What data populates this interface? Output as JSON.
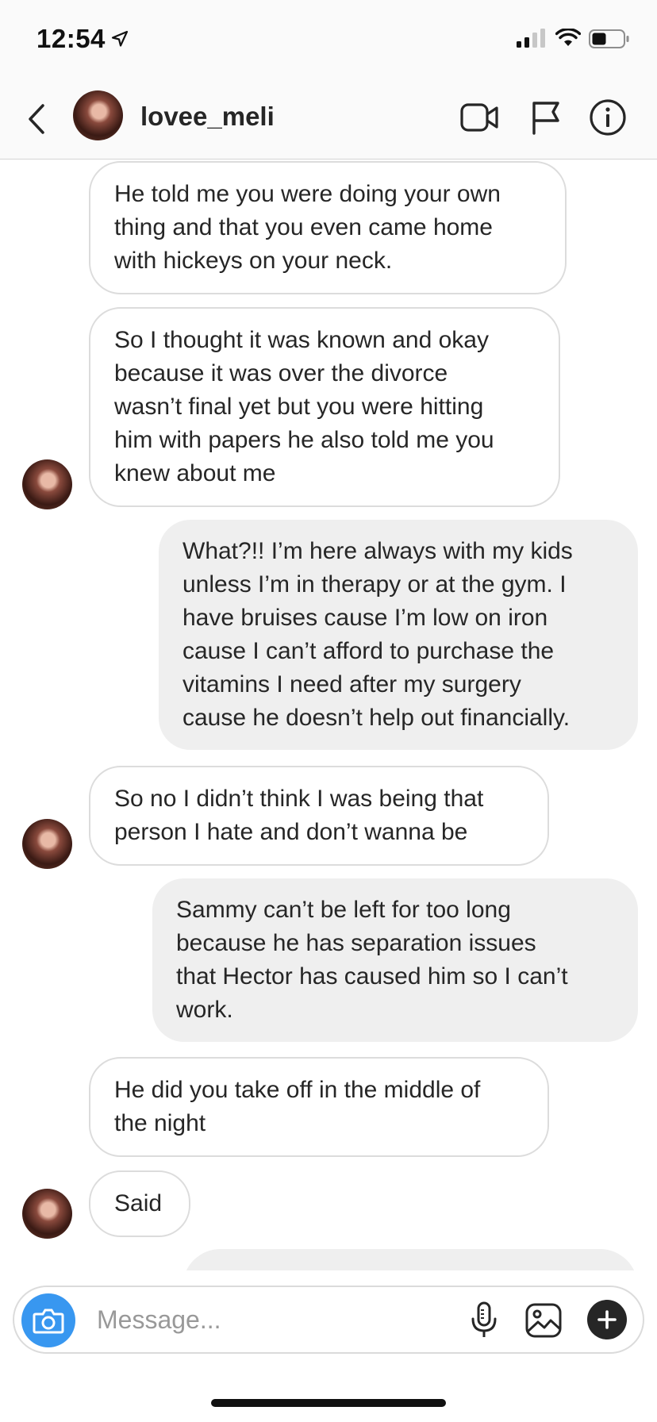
{
  "status_bar": {
    "time": "12:54"
  },
  "header": {
    "username": "lovee_meli"
  },
  "messages": [
    {
      "direction": "incoming",
      "text": "He told me you were doing your own\nthing and that you even came home\nwith hickeys on your neck."
    },
    {
      "direction": "incoming",
      "text": "So I thought it was known and okay\nbecause it was over the divorce\nwasn’t final yet but you were hitting\nhim with papers he also told me you\nknew about me"
    },
    {
      "direction": "outgoing",
      "text": "What?!! I’m here always with my kids\nunless I’m in therapy or at the gym. I\nhave bruises cause I’m low on iron\ncause I can’t afford to purchase the\nvitamins I need after my surgery\ncause he doesn’t help out financially."
    },
    {
      "direction": "incoming",
      "text": "So no I didn’t think I was being that\nperson I hate and don’t wanna be"
    },
    {
      "direction": "outgoing",
      "text": "Sammy can’t be left for too long\nbecause he has separation issues\nthat Hector has caused him so I can’t\nwork."
    },
    {
      "direction": "incoming",
      "text": "He did you take off in the middle of\nthe night"
    },
    {
      "direction": "incoming",
      "text": "Said"
    }
  ],
  "composer": {
    "placeholder": "Message..."
  },
  "colors": {
    "accent": "#3897f0",
    "outgoing_bubble": "#efefef",
    "incoming_border": "#dcdcdc"
  },
  "icons": [
    "location-arrow-icon",
    "signal-icon",
    "wifi-icon",
    "battery-icon",
    "back-chevron-icon",
    "video-call-icon",
    "flag-icon",
    "info-icon",
    "camera-icon",
    "microphone-icon",
    "gallery-icon",
    "plus-icon"
  ]
}
